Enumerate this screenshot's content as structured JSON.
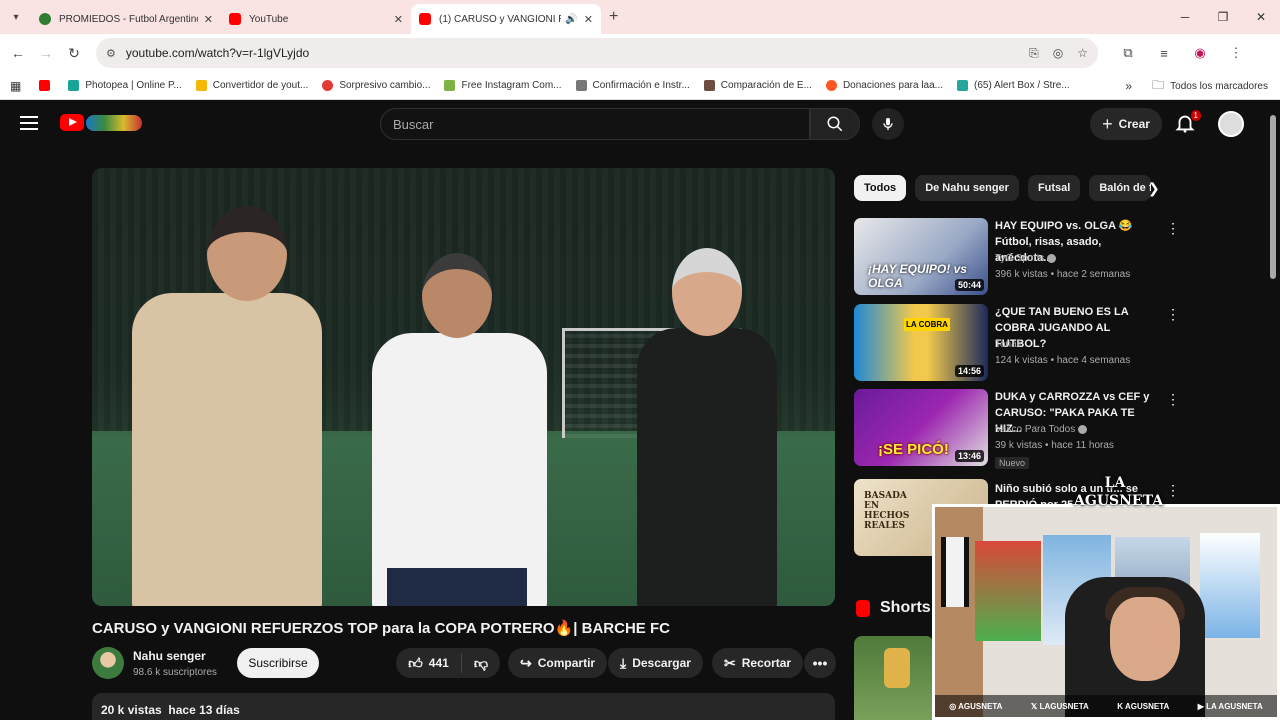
{
  "browser": {
    "tabs": [
      {
        "title": "PROMIEDOS - Futbol Argentino",
        "favicon_color": "#2e7d32"
      },
      {
        "title": "YouTube",
        "favicon_color": "#ff0000"
      },
      {
        "title": "(1) CARUSO y VANGIONI RE",
        "favicon_color": "#ff0000"
      }
    ],
    "url": "youtube.com/watch?v=r-1lgVLyjdo",
    "bookmarks": [
      {
        "label": "Photopea | Online P...",
        "color": "#18a497"
      },
      {
        "label": "Convertidor de yout...",
        "color": "#f5b700"
      },
      {
        "label": "Sorpresivo cambio...",
        "color": "#e53935"
      },
      {
        "label": "Free Instagram Com...",
        "color": "#7cb342"
      },
      {
        "label": "Confirmación e Instr...",
        "color": "#777777"
      },
      {
        "label": "Comparación de E...",
        "color": "#6d4c41"
      },
      {
        "label": "Donaciones para laa...",
        "color": "#ff5722"
      },
      {
        "label": "(65) Alert Box / Stre...",
        "color": "#26a69a"
      }
    ],
    "all_bookmarks": "Todos los marcadores"
  },
  "yt": {
    "search_placeholder": "Buscar",
    "create_label": "Crear",
    "notif_count": "1",
    "video": {
      "title": "CARUSO y VANGIONI REFUERZOS TOP para la COPA POTRERO🔥| BARCHE FC",
      "channel": "Nahu senger",
      "subscribers": "98.6 k suscriptores",
      "subscribe_label": "Suscribirse",
      "likes": "441",
      "share_label": "Compartir",
      "download_label": "Descargar",
      "clip_label": "Recortar",
      "views": "20 k vistas",
      "age": "hace 13 días"
    },
    "chips": [
      "Todos",
      "De Nahu senger",
      "Futsal",
      "Balón de f"
    ],
    "recommendations": [
      {
        "title": "HAY EQUIPO vs. OLGA 😂 Fútbol, risas, asado, anécdota...",
        "channel": "TyC Sports",
        "meta": "396 k vistas • hace 2 semanas",
        "duration": "50:44",
        "thumb_text": "¡HAY EQUIPO! vs OLGA"
      },
      {
        "title": "¿QUE TAN BUENO ES LA COBRA JUGANDO AL FUTBOL?",
        "channel": "Tonali",
        "meta": "124 k vistas • hace 4 semanas",
        "duration": "14:56",
        "thumb_text": "LA COBRA"
      },
      {
        "title": "DUKA y CARROZZA vs CEF y CARUSO: \"PAKA PAKA TE HIZ...",
        "channel": "Vasco Para Todos",
        "meta": "39 k vistas • hace 11 horas",
        "duration": "13:46",
        "thumb_text": "¡SE PICÓ!",
        "badge": "Nuevo"
      },
      {
        "title": "Niño subió solo a un tr... se PERDIÓ por 25...",
        "thumb_text": "BASADA EN HECHOS REALES"
      }
    ],
    "shorts_label": "Shorts"
  },
  "overlay": {
    "logo_line1": "LA",
    "logo_line2": "AGUSNETA",
    "socials": [
      "AGUSNETA",
      "LAGUSNETA",
      "AGUSNETA",
      "LA AGUSNETA"
    ]
  }
}
